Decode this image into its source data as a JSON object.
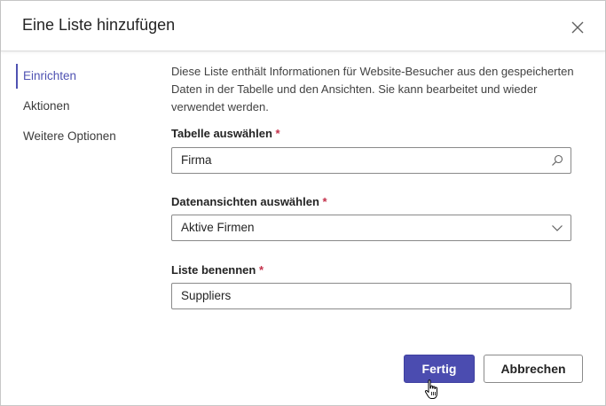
{
  "dialog": {
    "title": "Eine Liste hinzufügen"
  },
  "nav": {
    "items": [
      {
        "label": "Einrichten",
        "active": true
      },
      {
        "label": "Aktionen",
        "active": false
      },
      {
        "label": "Weitere Optionen",
        "active": false
      }
    ]
  },
  "content": {
    "description": "Diese Liste enthält Informationen für Website-Besucher aus den gespeicherten Daten in der Tabelle und den Ansichten. Sie kann bearbeitet und wieder verwendet werden.",
    "table": {
      "label": "Tabelle auswählen",
      "required_mark": "*",
      "value": "Firma"
    },
    "views": {
      "label": "Datenansichten auswählen",
      "required_mark": "*",
      "value": "Aktive Firmen"
    },
    "name": {
      "label": "Liste benennen",
      "required_mark": "*",
      "value": "Suppliers"
    }
  },
  "footer": {
    "done_label": "Fertig",
    "cancel_label": "Abbrechen"
  },
  "icons": {
    "close": "close-icon",
    "search": "search-icon",
    "dropdown": "chevron-down-icon",
    "cursor": "hand-pointer-cursor"
  },
  "colors": {
    "accent": "#4b4cb0",
    "nav_active": "#4f52b2",
    "required": "#c4314b"
  }
}
